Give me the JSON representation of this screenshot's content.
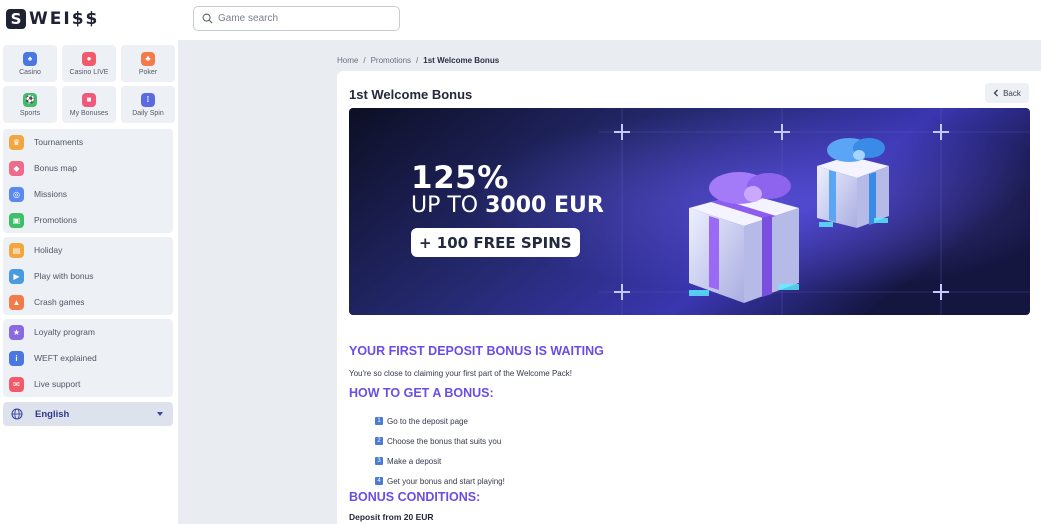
{
  "brand": {
    "badge": "S",
    "name": "WEI$$"
  },
  "search": {
    "placeholder": "Game search"
  },
  "tiles": [
    {
      "label": "Casino",
      "icon": "casino-icon",
      "color": "#4a78e0"
    },
    {
      "label": "Casino LIVE",
      "icon": "casino-live-icon",
      "color": "#f05a6a"
    },
    {
      "label": "Poker",
      "icon": "poker-icon",
      "color": "#f37a4a"
    },
    {
      "label": "Sports",
      "icon": "sports-icon",
      "color": "#3fbf6a"
    },
    {
      "label": "My Bonuses",
      "icon": "gift-icon",
      "color": "#f05a7a"
    },
    {
      "label": "Daily Spin",
      "icon": "daily-spin-icon",
      "color": "#5a6ae0"
    }
  ],
  "nav_groups": [
    [
      {
        "label": "Tournaments",
        "icon": "trophy-icon",
        "color": "#f2a640"
      },
      {
        "label": "Bonus map",
        "icon": "map-icon",
        "color": "#f06a8a"
      },
      {
        "label": "Missions",
        "icon": "target-icon",
        "color": "#5a8af0"
      },
      {
        "label": "Promotions",
        "icon": "ticket-icon",
        "color": "#3fbf6a"
      }
    ],
    [
      {
        "label": "Holiday",
        "icon": "calendar-icon",
        "color": "#f2a640"
      },
      {
        "label": "Play with bonus",
        "icon": "bonus-play-icon",
        "color": "#4a9ae0"
      },
      {
        "label": "Crash games",
        "icon": "rocket-icon",
        "color": "#f37a4a"
      }
    ],
    [
      {
        "label": "Loyalty program",
        "icon": "loyalty-icon",
        "color": "#8a6ae0"
      },
      {
        "label": "WEFT explained",
        "icon": "info-icon",
        "color": "#4a78e0"
      },
      {
        "label": "Live support",
        "icon": "chat-icon",
        "color": "#f05a6a"
      }
    ]
  ],
  "language": {
    "label": "English"
  },
  "breadcrumb": {
    "home": "Home",
    "sep": "/",
    "section": "Promotions",
    "current": "1st Welcome Bonus"
  },
  "page": {
    "title": "1st Welcome Bonus",
    "back_label": "Back",
    "banner": {
      "percent": "125%",
      "up_to": "UP TO",
      "amount": "3000 EUR",
      "spins": "+ 100 FREE SPINS"
    },
    "heading1": "YOUR FIRST DEPOSIT BONUS IS WAITING",
    "intro": "You're so close to claiming your first part of the Welcome Pack!",
    "heading2": "HOW TO GET A BONUS:",
    "steps": [
      {
        "num": "1",
        "text": "Go to the deposit page"
      },
      {
        "num": "2",
        "text": "Choose the bonus that suits you"
      },
      {
        "num": "3",
        "text": "Make a deposit"
      },
      {
        "num": "4",
        "text": "Get your bonus and start playing!"
      }
    ],
    "heading3": "BONUS CONDITIONS:",
    "condition": "Deposit from 20 EUR"
  }
}
